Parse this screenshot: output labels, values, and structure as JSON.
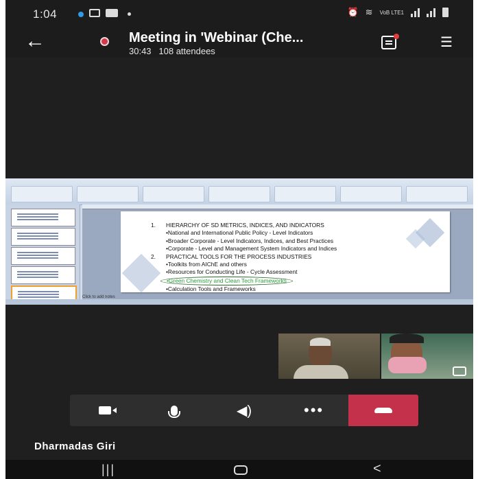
{
  "status_bar": {
    "time": "1:04",
    "network": "VoB LTE1"
  },
  "header": {
    "title": "Meeting in 'Webinar (Che...",
    "duration": "30:43",
    "attendees": "108 attendees"
  },
  "slide": {
    "items": [
      {
        "type": "heading",
        "num": "1.",
        "text": "HIERARCHY OF SD METRICS, INDICES, AND INDICATORS"
      },
      {
        "type": "bullet",
        "text": "•National and International Public Policy - Level Indicators"
      },
      {
        "type": "bullet",
        "text": "•Broader Corporate - Level Indicators, Indices, and Best Practices"
      },
      {
        "type": "bullet",
        "text": "•Corporate - Level and Management System Indicators and Indices"
      },
      {
        "type": "heading",
        "num": "2.",
        "text": "PRACTICAL TOOLS FOR THE PROCESS INDUSTRIES"
      },
      {
        "type": "bullet",
        "text": "•Toolkits from AIChE and others"
      },
      {
        "type": "bullet",
        "text": "•Resources for Conducting Life - Cycle Assessment"
      },
      {
        "type": "highlight",
        "text": "•Green Chemistry and Clean Tech Frameworks"
      },
      {
        "type": "bullet",
        "text": "•Calculation Tools and Frameworks"
      }
    ],
    "notes_placeholder": "Click to add notes"
  },
  "participant": {
    "name": "Dharmadas Giri"
  },
  "colors": {
    "end_call": "#c4314b",
    "recording": "#d23a4b",
    "highlight_text": "#2a9a3a"
  }
}
